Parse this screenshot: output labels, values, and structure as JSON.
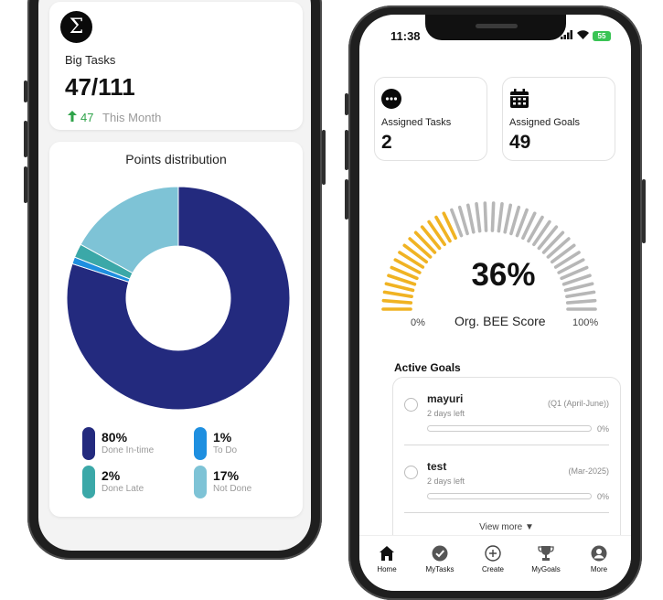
{
  "left_phone": {
    "big_tasks": {
      "icon": "sigma-icon",
      "title": "Big Tasks",
      "value": "47/111",
      "trend_icon": "arrow-up-icon",
      "trend_count": "47",
      "trend_label": "This Month"
    },
    "points_distribution": {
      "title": "Points distribution",
      "legend": [
        {
          "pct": "80%",
          "label": "Done In-time",
          "color": "#232a7e"
        },
        {
          "pct": "1%",
          "label": "To Do",
          "color": "#1e8fe0"
        },
        {
          "pct": "2%",
          "label": "Done Late",
          "color": "#3ba8a8"
        },
        {
          "pct": "17%",
          "label": "Not Done",
          "color": "#7ec3d6"
        }
      ]
    }
  },
  "chart_data": {
    "type": "pie",
    "title": "Points distribution",
    "categories": [
      "Done In-time",
      "To Do",
      "Done Late",
      "Not Done"
    ],
    "values": [
      80,
      1,
      2,
      17
    ],
    "colors": [
      "#232a7e",
      "#1e8fe0",
      "#3ba8a8",
      "#7ec3d6"
    ]
  },
  "right_phone": {
    "status_bar": {
      "time": "11:38",
      "battery": "55"
    },
    "assigned_tasks": {
      "icon": "more-dots-icon",
      "label": "Assigned Tasks",
      "value": "2"
    },
    "assigned_goals": {
      "icon": "calendar-icon",
      "label": "Assigned Goals",
      "value": "49"
    },
    "gauge": {
      "value": 36,
      "value_text": "36%",
      "label": "Org. BEE Score",
      "min_label": "0%",
      "max_label": "100%",
      "active_color": "#f0b323",
      "inactive_color": "#b7b7b7"
    },
    "active_goals": {
      "title": "Active Goals",
      "goals": [
        {
          "name": "mayuri",
          "days_left": "2 days left",
          "period": "(Q1 (April-June))",
          "progress": 0,
          "progress_text": "0%"
        },
        {
          "name": "test",
          "days_left": "2 days left",
          "period": "(Mar-2025)",
          "progress": 0,
          "progress_text": "0%"
        }
      ],
      "view_more": "View more ▼"
    },
    "nav": [
      {
        "label": "Home",
        "icon": "home-icon"
      },
      {
        "label": "MyTasks",
        "icon": "check-circle-icon"
      },
      {
        "label": "Create",
        "icon": "plus-circle-icon"
      },
      {
        "label": "MyGoals",
        "icon": "trophy-icon"
      },
      {
        "label": "More",
        "icon": "user-circle-icon"
      }
    ]
  }
}
